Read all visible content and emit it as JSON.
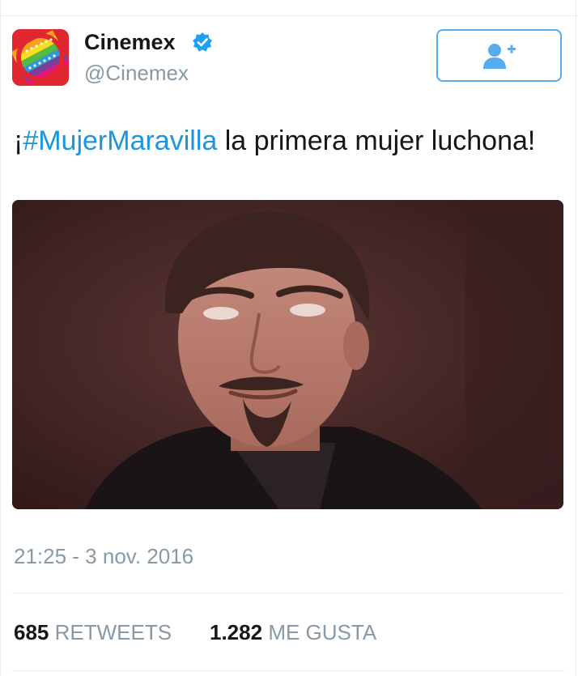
{
  "author": {
    "display_name": "Cinemex",
    "handle": "@Cinemex",
    "verified": true
  },
  "follow_button": {
    "icon": "add-user-icon",
    "color": "#55acee"
  },
  "tweet": {
    "prefix": "¡",
    "hashtag": "#MujerMaravilla",
    "text": " la primera mujer luchona!"
  },
  "media": {
    "description_icon": "photo"
  },
  "timestamp": "21:25 - 3 nov. 2016",
  "stats": {
    "retweets_count": "685",
    "retweets_label": "RETWEETS",
    "likes_count": "1.282",
    "likes_label": "ME GUSTA"
  },
  "colors": {
    "link": "#1b95e0",
    "muted": "#8899a6",
    "verified": "#1da1f2",
    "brand": "#e0262e"
  }
}
